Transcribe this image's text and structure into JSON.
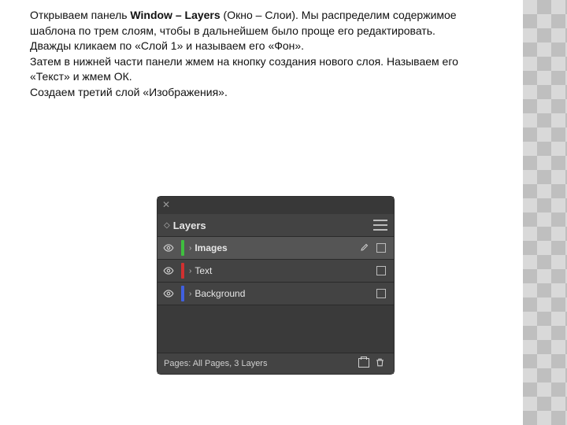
{
  "instructions": {
    "line1_a": "Открываем панель ",
    "line1_b": "Window – Layers",
    "line1_c": " (Окно – Слои). Мы распределим содержимое шаблона по трем слоям, чтобы в дальнейшем было проще его редактировать.",
    "line2": "Дважды кликаем по «Слой 1» и называем его «Фон».",
    "line3": "Затем в нижней части панели жмем на кнопку создания нового слоя. Называем его «Текст» и жмем ОК.",
    "line4": "Создаем третий слой «Изображения»."
  },
  "panel": {
    "title": "Layers",
    "layers": [
      {
        "name": "Images",
        "color": "#3fbf3f",
        "selected": true,
        "pen": true
      },
      {
        "name": "Text",
        "color": "#d03030",
        "selected": false,
        "pen": false
      },
      {
        "name": "Background",
        "color": "#4060e0",
        "selected": false,
        "pen": false
      }
    ],
    "footer": "Pages: All Pages, 3 Layers"
  }
}
